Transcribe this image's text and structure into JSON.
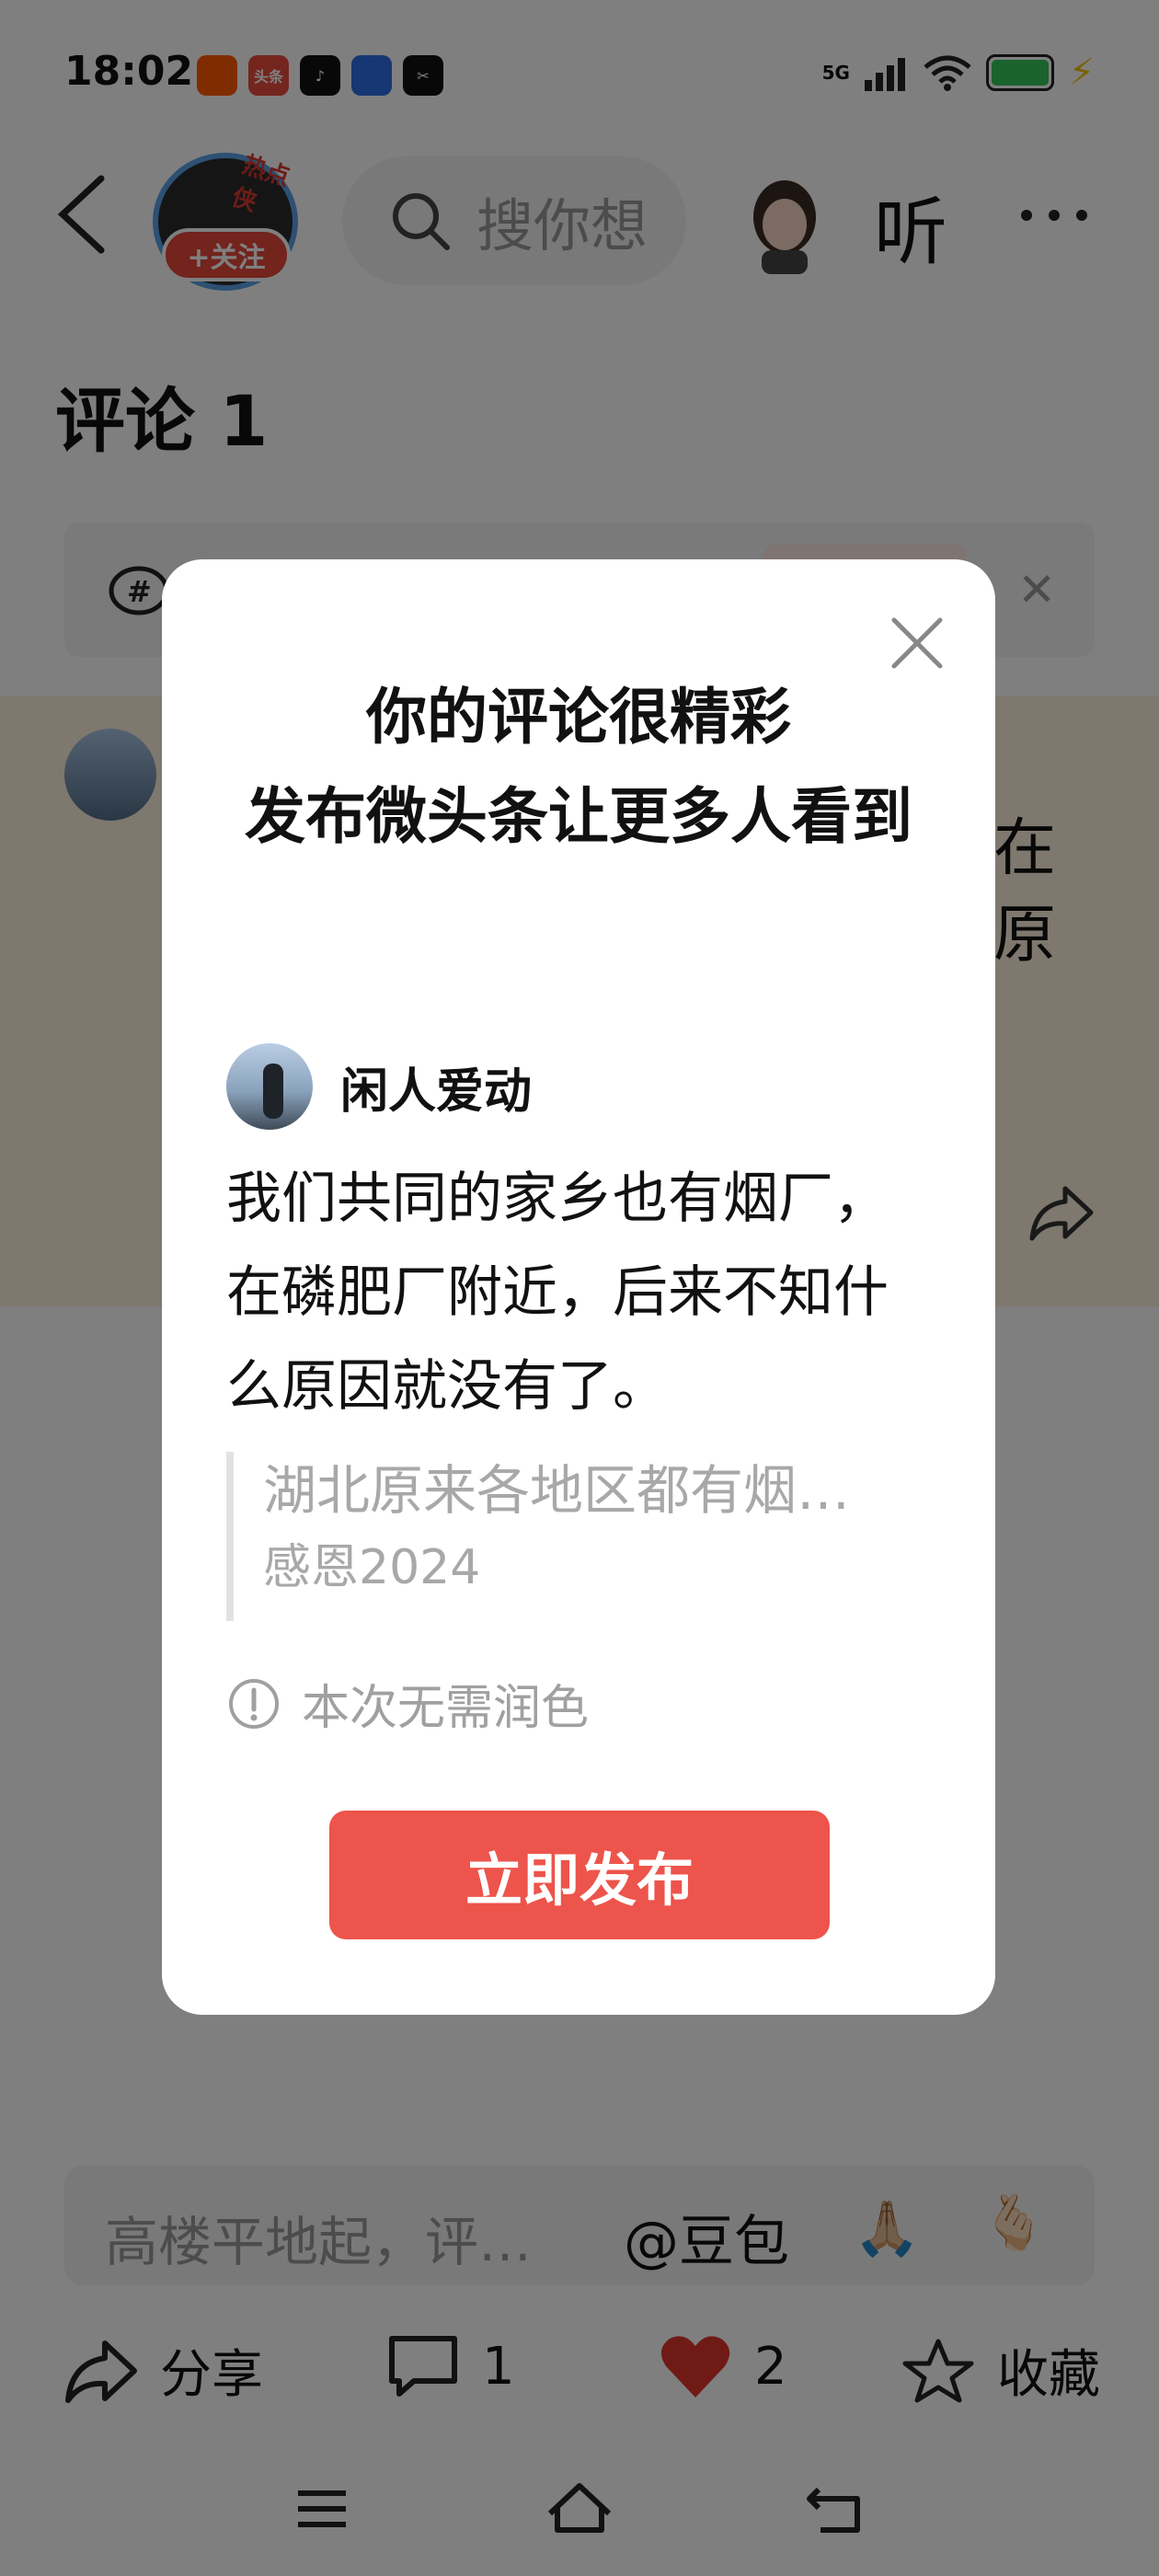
{
  "status_bar": {
    "time": "18:02",
    "network": "5G",
    "app_icons": [
      {
        "name": "shopping-app-icon",
        "color": "#ff5a00",
        "text": ""
      },
      {
        "name": "toutiao-app-icon",
        "color": "#e84a3c",
        "text": "头条"
      },
      {
        "name": "douyin-app-icon",
        "color": "#111111",
        "text": "♪"
      },
      {
        "name": "baidu-app-icon",
        "color": "#2f6ee7",
        "text": ""
      },
      {
        "name": "capcut-app-icon",
        "color": "#111111",
        "text": "✂"
      }
    ],
    "battery_color": "#34c759"
  },
  "header": {
    "follow_label": "+关注",
    "hot_tag": "热点侠",
    "search_placeholder": "搜你想",
    "listen_label": "听"
  },
  "page": {
    "comments_title": "评论 1",
    "comment_fragment_1": "在",
    "comment_fragment_2": "原"
  },
  "dialog": {
    "title_line1": "你的评论很精彩",
    "title_line2": "发布微头条让更多人看到",
    "author_name": "闲人爱动",
    "comment_text": "我们共同的家乡也有烟厂，在磷肥厂附近，后来不知什么原因就没有了。",
    "quote_title": "湖北原来各地区都有烟…",
    "quote_author": "感恩2024",
    "notice_text": "本次无需润色",
    "publish_label": "立即发布",
    "accent_color": "#ed544b"
  },
  "bottom_input": {
    "placeholder": "高楼平地起，评…",
    "doubao_label": "@豆包",
    "emoji_1": "🙏🏼",
    "emoji_2": "🫰🏻"
  },
  "action_bar": {
    "share_label": "分享",
    "comment_count": "1",
    "like_count": "2",
    "collect_label": "收藏",
    "like_color": "#e0352b"
  }
}
